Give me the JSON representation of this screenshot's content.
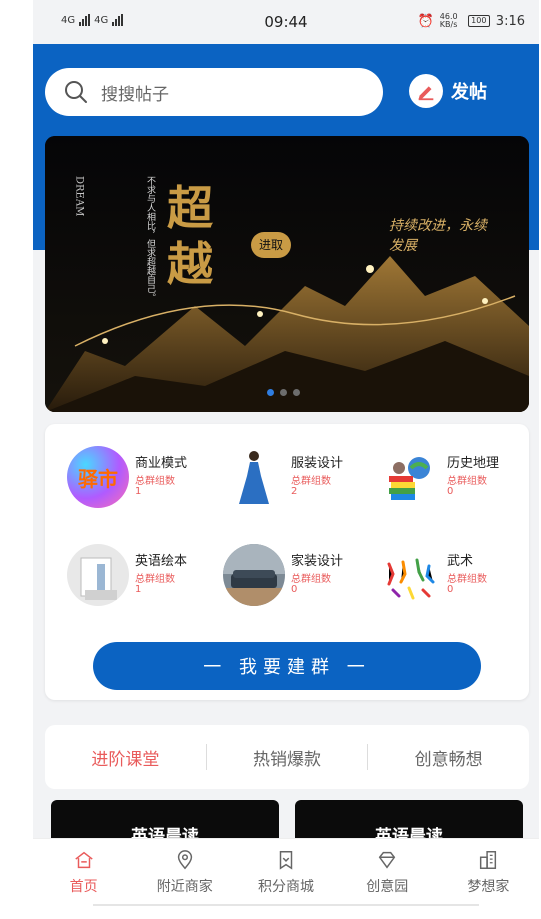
{
  "status_bar": {
    "network_left": "4G",
    "network_right": "4G",
    "time": "09:44",
    "net_speed": "46.0 KB/s",
    "battery": "100",
    "right_time": "3:16"
  },
  "header": {
    "search_placeholder": "搜搜帖子",
    "post_label": "发帖"
  },
  "banner": {
    "title": "超越",
    "badge": "进取",
    "slogan": "持续改进，永续发展",
    "vertical_text": "不求与人相比，但求超越自己。",
    "english": "DREAM",
    "page_count": 3,
    "active_page": 0
  },
  "categories": [
    {
      "name": "商业模式",
      "label": "总群组数",
      "count": "1",
      "thumb_text": "驿市"
    },
    {
      "name": "服装设计",
      "label": "总群组数",
      "count": "2"
    },
    {
      "name": "历史地理",
      "label": "总群组数",
      "count": "0"
    },
    {
      "name": "英语绘本",
      "label": "总群组数",
      "count": "1"
    },
    {
      "name": "家装设计",
      "label": "总群组数",
      "count": "0"
    },
    {
      "name": "武术",
      "label": "总群组数",
      "count": "0"
    }
  ],
  "build_button": "一 我要建群 一",
  "tabs": [
    {
      "label": "进阶课堂",
      "active": true
    },
    {
      "label": "热销爆款",
      "active": false
    },
    {
      "label": "创意畅想",
      "active": false
    }
  ],
  "cards_peek": [
    "英语晨读",
    "英语晨读"
  ],
  "bottom_nav": [
    {
      "label": "首页",
      "icon": "home-icon",
      "active": true
    },
    {
      "label": "附近商家",
      "icon": "location-icon",
      "active": false
    },
    {
      "label": "积分商城",
      "icon": "bookmark-icon",
      "active": false
    },
    {
      "label": "创意园",
      "icon": "diamond-icon",
      "active": false
    },
    {
      "label": "梦想家",
      "icon": "building-icon",
      "active": false
    }
  ],
  "colors": {
    "brand_blue": "#0b63c2",
    "accent_red": "#e95b5b"
  }
}
